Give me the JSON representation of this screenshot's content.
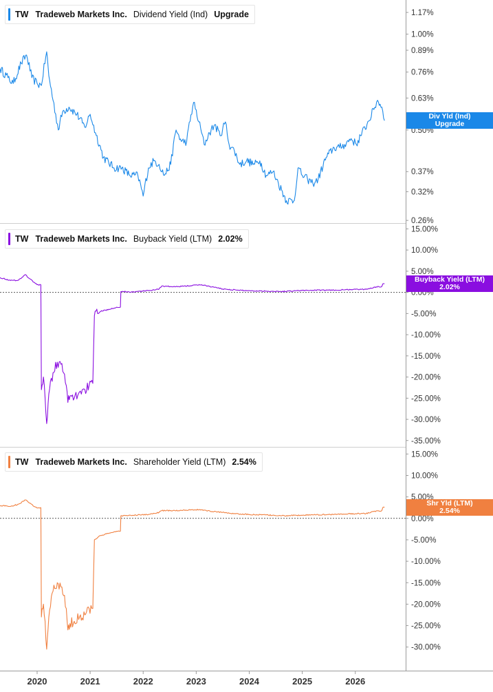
{
  "chart_data": [
    {
      "type": "line",
      "ticker": "TW",
      "company": "Tradeweb Markets Inc.",
      "metric": "Dividend Yield (Ind)",
      "value_label": "Upgrade",
      "flag_label": "Div Yld (Ind)",
      "flag_value": "Upgrade",
      "color": "#1a88e8",
      "yscale": "log",
      "ylim": [
        0.255,
        1.28
      ],
      "yticks": [
        1.17,
        1.0,
        0.89,
        0.76,
        0.63,
        0.5,
        0.37,
        0.32,
        0.26
      ],
      "ytick_labels": [
        "1.17%",
        "1.00%",
        "0.89%",
        "0.76%",
        "0.63%",
        "0.50%",
        "0.37%",
        "0.32%",
        "0.26%"
      ],
      "current_value": 0.535,
      "series": [
        {
          "values": [
            [
              2019.3,
              0.78
            ],
            [
              2019.45,
              0.73
            ],
            [
              2019.55,
              0.7
            ],
            [
              2019.7,
              0.81
            ],
            [
              2019.8,
              0.86
            ],
            [
              2019.9,
              0.73
            ],
            [
              2020.0,
              0.7
            ],
            [
              2020.08,
              0.69
            ],
            [
              2020.18,
              0.88
            ],
            [
              2020.22,
              0.74
            ],
            [
              2020.3,
              0.62
            ],
            [
              2020.4,
              0.5
            ],
            [
              2020.48,
              0.57
            ],
            [
              2020.6,
              0.59
            ],
            [
              2020.75,
              0.56
            ],
            [
              2020.9,
              0.51
            ],
            [
              2021.0,
              0.56
            ],
            [
              2021.1,
              0.49
            ],
            [
              2021.25,
              0.41
            ],
            [
              2021.45,
              0.38
            ],
            [
              2021.6,
              0.38
            ],
            [
              2021.75,
              0.36
            ],
            [
              2021.9,
              0.36
            ],
            [
              2022.0,
              0.31
            ],
            [
              2022.1,
              0.38
            ],
            [
              2022.2,
              0.4
            ],
            [
              2022.3,
              0.39
            ],
            [
              2022.4,
              0.36
            ],
            [
              2022.52,
              0.39
            ],
            [
              2022.62,
              0.5
            ],
            [
              2022.72,
              0.46
            ],
            [
              2022.82,
              0.46
            ],
            [
              2022.95,
              0.61
            ],
            [
              2023.05,
              0.53
            ],
            [
              2023.15,
              0.45
            ],
            [
              2023.25,
              0.49
            ],
            [
              2023.35,
              0.52
            ],
            [
              2023.45,
              0.48
            ],
            [
              2023.55,
              0.53
            ],
            [
              2023.62,
              0.45
            ],
            [
              2023.72,
              0.43
            ],
            [
              2023.82,
              0.39
            ],
            [
              2023.95,
              0.4
            ],
            [
              2024.1,
              0.39
            ],
            [
              2024.2,
              0.4
            ],
            [
              2024.32,
              0.36
            ],
            [
              2024.45,
              0.37
            ],
            [
              2024.55,
              0.34
            ],
            [
              2024.7,
              0.3
            ],
            [
              2024.85,
              0.3
            ],
            [
              2024.92,
              0.38
            ],
            [
              2025.0,
              0.36
            ],
            [
              2025.1,
              0.35
            ],
            [
              2025.2,
              0.34
            ],
            [
              2025.3,
              0.35
            ],
            [
              2025.45,
              0.41
            ],
            [
              2025.6,
              0.44
            ],
            [
              2025.7,
              0.44
            ],
            [
              2025.8,
              0.45
            ],
            [
              2025.92,
              0.47
            ],
            [
              2026.02,
              0.45
            ],
            [
              2026.1,
              0.48
            ],
            [
              2026.22,
              0.52
            ],
            [
              2026.35,
              0.58
            ],
            [
              2026.42,
              0.62
            ],
            [
              2026.5,
              0.59
            ],
            [
              2026.55,
              0.535
            ]
          ]
        }
      ]
    },
    {
      "type": "line",
      "ticker": "TW",
      "company": "Tradeweb Markets Inc.",
      "metric": "Buyback Yield (LTM)",
      "value_label": "2.02%",
      "flag_label": "Buyback Yield (LTM)",
      "flag_value": "2.02%",
      "color": "#8a0ee0",
      "ylim": [
        -36.5,
        16.2
      ],
      "yticks": [
        15,
        10,
        5,
        0,
        -5,
        -10,
        -15,
        -20,
        -25,
        -30,
        -35
      ],
      "ytick_labels": [
        "15.00%",
        "10.00%",
        "5.00%",
        "0.00%",
        "-5.00%",
        "-10.00%",
        "-15.00%",
        "-20.00%",
        "-25.00%",
        "-30.00%",
        "-35.00%"
      ],
      "current_value": 2.02,
      "series": [
        {
          "values": [
            [
              2019.3,
              3.5
            ],
            [
              2019.5,
              2.8
            ],
            [
              2019.65,
              2.9
            ],
            [
              2019.78,
              4.2
            ],
            [
              2019.85,
              3.3
            ],
            [
              2020.0,
              1.8
            ],
            [
              2020.07,
              1.8
            ],
            [
              2020.08,
              -23
            ],
            [
              2020.12,
              -20
            ],
            [
              2020.15,
              -25
            ],
            [
              2020.18,
              -31
            ],
            [
              2020.22,
              -24
            ],
            [
              2020.3,
              -19
            ],
            [
              2020.38,
              -16.5
            ],
            [
              2020.45,
              -17
            ],
            [
              2020.5,
              -19
            ],
            [
              2020.55,
              -22
            ],
            [
              2020.58,
              -26
            ],
            [
              2020.62,
              -24.5
            ],
            [
              2020.7,
              -25
            ],
            [
              2020.8,
              -23.5
            ],
            [
              2020.9,
              -23
            ],
            [
              2020.98,
              -22
            ],
            [
              2021.05,
              -21.5
            ],
            [
              2021.08,
              -5.5
            ],
            [
              2021.2,
              -4.5
            ],
            [
              2021.35,
              -4
            ],
            [
              2021.5,
              -3.5
            ],
            [
              2021.57,
              -3.5
            ],
            [
              2021.58,
              0.2
            ],
            [
              2021.8,
              0.1
            ],
            [
              2022.1,
              0.4
            ],
            [
              2022.3,
              0.8
            ],
            [
              2022.35,
              1.5
            ],
            [
              2022.6,
              1.3
            ],
            [
              2022.9,
              1.6
            ],
            [
              2023.1,
              1.8
            ],
            [
              2023.3,
              1.3
            ],
            [
              2023.5,
              0.8
            ],
            [
              2023.8,
              0.5
            ],
            [
              2024.0,
              0.4
            ],
            [
              2024.3,
              0.3
            ],
            [
              2024.6,
              0.2
            ],
            [
              2024.9,
              0.4
            ],
            [
              2025.2,
              0.5
            ],
            [
              2025.5,
              0.5
            ],
            [
              2025.8,
              0.6
            ],
            [
              2026.0,
              0.7
            ],
            [
              2026.2,
              0.7
            ],
            [
              2026.35,
              1.2
            ],
            [
              2026.5,
              1.4
            ],
            [
              2026.52,
              2.02
            ],
            [
              2026.55,
              2.02
            ]
          ]
        }
      ]
    },
    {
      "type": "line",
      "ticker": "TW",
      "company": "Tradeweb Markets Inc.",
      "metric": "Shareholder Yield (LTM)",
      "value_label": "2.54%",
      "flag_label": "Shr Yld (LTM)",
      "flag_value": "2.54%",
      "color": "#f08040",
      "ylim": [
        -35.5,
        16.5
      ],
      "yticks": [
        15,
        10,
        5,
        0,
        -5,
        -10,
        -15,
        -20,
        -25,
        -30
      ],
      "ytick_labels": [
        "15.00%",
        "10.00%",
        "5.00%",
        "0.00%",
        "-5.00%",
        "-10.00%",
        "-15.00%",
        "-20.00%",
        "-25.00%",
        "-30.00%"
      ],
      "current_value": 2.54,
      "series": [
        {
          "values": [
            [
              2019.3,
              3.0
            ],
            [
              2019.5,
              2.8
            ],
            [
              2019.65,
              3.3
            ],
            [
              2019.78,
              4.3
            ],
            [
              2019.85,
              3.6
            ],
            [
              2020.0,
              2.4
            ],
            [
              2020.07,
              2.5
            ],
            [
              2020.08,
              -23
            ],
            [
              2020.12,
              -20
            ],
            [
              2020.15,
              -24
            ],
            [
              2020.18,
              -30.5
            ],
            [
              2020.22,
              -23
            ],
            [
              2020.3,
              -17
            ],
            [
              2020.38,
              -15
            ],
            [
              2020.45,
              -16
            ],
            [
              2020.5,
              -18
            ],
            [
              2020.55,
              -21
            ],
            [
              2020.58,
              -26
            ],
            [
              2020.62,
              -24.5
            ],
            [
              2020.7,
              -24
            ],
            [
              2020.8,
              -23
            ],
            [
              2020.9,
              -22.5
            ],
            [
              2020.98,
              -21
            ],
            [
              2021.05,
              -21
            ],
            [
              2021.08,
              -5
            ],
            [
              2021.2,
              -4
            ],
            [
              2021.35,
              -3.5
            ],
            [
              2021.5,
              -3
            ],
            [
              2021.57,
              -3
            ],
            [
              2021.58,
              0.6
            ],
            [
              2021.8,
              0.7
            ],
            [
              2022.1,
              0.9
            ],
            [
              2022.3,
              1.4
            ],
            [
              2022.35,
              1.8
            ],
            [
              2022.6,
              1.8
            ],
            [
              2022.9,
              2.0
            ],
            [
              2023.1,
              2.0
            ],
            [
              2023.3,
              1.6
            ],
            [
              2023.5,
              1.4
            ],
            [
              2023.8,
              1.0
            ],
            [
              2024.0,
              0.9
            ],
            [
              2024.3,
              0.8
            ],
            [
              2024.6,
              0.6
            ],
            [
              2024.9,
              0.7
            ],
            [
              2025.2,
              0.8
            ],
            [
              2025.5,
              0.9
            ],
            [
              2025.8,
              1.0
            ],
            [
              2026.0,
              1.1
            ],
            [
              2026.2,
              1.1
            ],
            [
              2026.35,
              1.6
            ],
            [
              2026.5,
              1.8
            ],
            [
              2026.52,
              2.54
            ],
            [
              2026.55,
              2.54
            ]
          ]
        }
      ]
    }
  ],
  "x_axis": {
    "labels": [
      "2020",
      "2021",
      "2022",
      "2023",
      "2024",
      "2025",
      "2026"
    ],
    "values": [
      2020,
      2021,
      2022,
      2023,
      2024,
      2025,
      2026
    ],
    "range": [
      2019.3,
      2026.95
    ]
  }
}
